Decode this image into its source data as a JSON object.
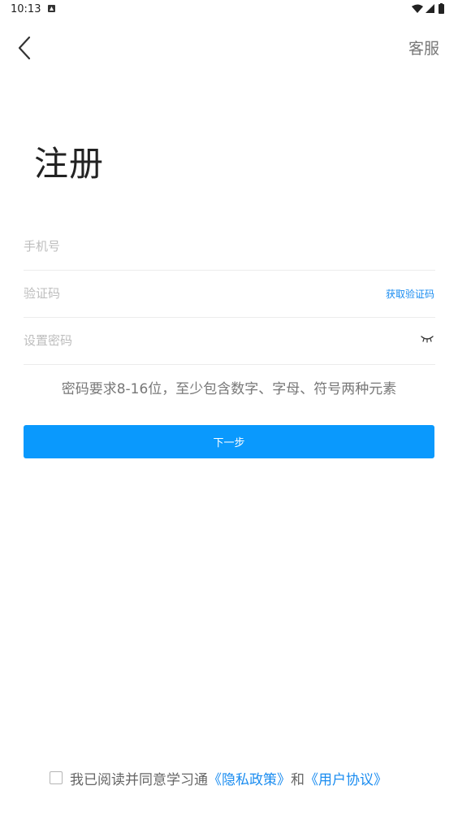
{
  "status_bar": {
    "time": "10:13"
  },
  "header": {
    "service_label": "客服"
  },
  "title": "注册",
  "form": {
    "phone_placeholder": "手机号",
    "code_placeholder": "验证码",
    "get_code_label": "获取验证码",
    "password_placeholder": "设置密码"
  },
  "password_hint": "密码要求8-16位，至少包含数字、字母、符号两种元素",
  "next_button_label": "下一步",
  "agreement": {
    "checked": false,
    "prefix": "我已阅读并同意学习通",
    "privacy_link": "《隐私政策》",
    "connector": "和",
    "user_agreement_link": "《用户协议》"
  },
  "colors": {
    "accent": "#0a99fd",
    "link": "#1a8cf0",
    "hint_text": "#777777",
    "placeholder": "#bdbdbd"
  },
  "icons": [
    "back-arrow-icon",
    "eye-closed-icon",
    "wifi-icon",
    "signal-icon",
    "battery-icon",
    "notification-icon"
  ]
}
